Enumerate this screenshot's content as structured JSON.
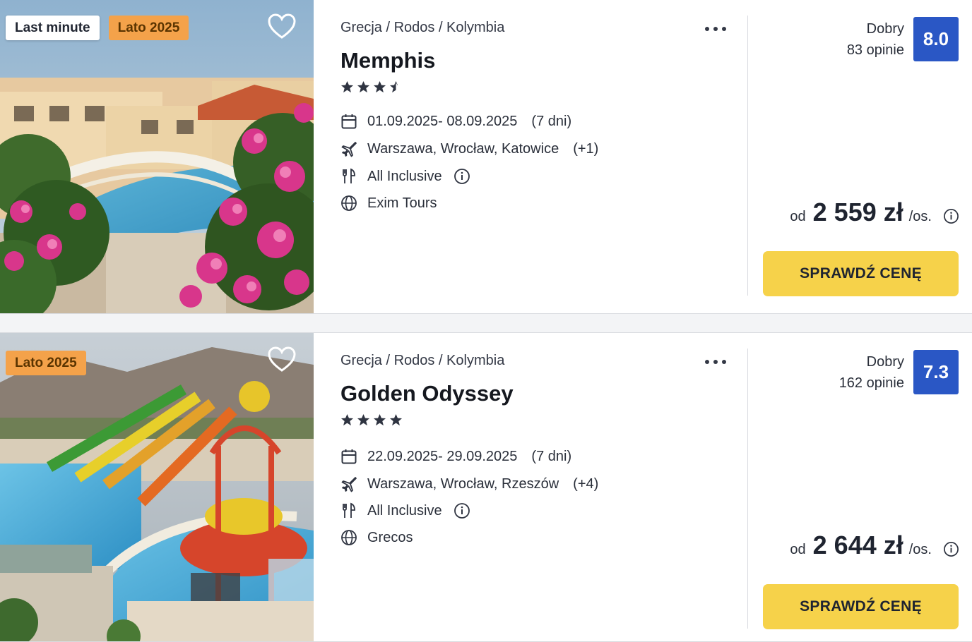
{
  "offers": [
    {
      "badges": [
        "Last minute",
        "Lato 2025"
      ],
      "breadcrumb": "Grecja / Rodos / Kolymbia",
      "name": "Memphis",
      "stars": 3.5,
      "dates": "01.09.2025- 08.09.2025",
      "duration": "(7 dni)",
      "departures": "Warszawa, Wrocław, Katowice",
      "departures_more": "(+1)",
      "board": "All Inclusive",
      "operator": "Exim Tours",
      "rating_label": "Dobry",
      "reviews": "83 opinie",
      "score": "8.0",
      "price_prefix": "od",
      "price": "2 559 zł",
      "price_suffix": "/os.",
      "cta": "SPRAWDŹ CENĘ"
    },
    {
      "badges": [
        "Lato 2025"
      ],
      "breadcrumb": "Grecja / Rodos / Kolymbia",
      "name": "Golden Odyssey",
      "stars": 4,
      "dates": "22.09.2025- 29.09.2025",
      "duration": "(7 dni)",
      "departures": "Warszawa, Wrocław, Rzeszów",
      "departures_more": "(+4)",
      "board": "All Inclusive",
      "operator": "Grecos",
      "rating_label": "Dobry",
      "reviews": "162 opinie",
      "score": "7.3",
      "price_prefix": "od",
      "price": "2 644 zł",
      "price_suffix": "/os.",
      "cta": "SPRAWDŹ CENĘ"
    }
  ],
  "icons": {
    "favorite": "heart-outline-icon",
    "menu": "more-dots-icon",
    "dates": "calendar-icon",
    "departures": "plane-icon",
    "board": "cutlery-icon",
    "board_info": "info-icon",
    "operator": "globe-icon",
    "price_info": "info-icon"
  },
  "colors": {
    "score_bg": "#2a57c5",
    "cta_bg": "#f6d24a",
    "badge_orange": "#f4a24a"
  }
}
